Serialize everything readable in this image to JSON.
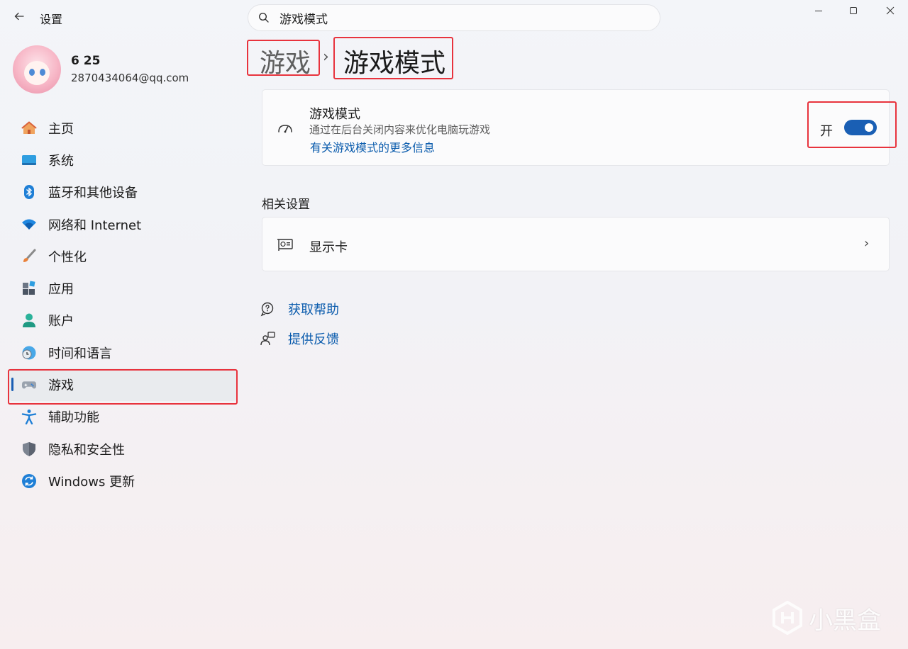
{
  "window": {
    "back_icon": "back-arrow-icon",
    "title": "设置",
    "controls": [
      "minimize-icon",
      "maximize-icon",
      "close-icon"
    ]
  },
  "search": {
    "value": "游戏模式",
    "icon": "search-icon"
  },
  "user": {
    "name": "6 25",
    "email": "2870434064@qq.com"
  },
  "sidebar": {
    "items": [
      {
        "label": "主页",
        "icon": "home-icon"
      },
      {
        "label": "系统",
        "icon": "system-monitor-icon"
      },
      {
        "label": "蓝牙和其他设备",
        "icon": "bluetooth-icon"
      },
      {
        "label": "网络和 Internet",
        "icon": "wifi-icon"
      },
      {
        "label": "个性化",
        "icon": "paintbrush-icon"
      },
      {
        "label": "应用",
        "icon": "apps-icon"
      },
      {
        "label": "账户",
        "icon": "account-icon"
      },
      {
        "label": "时间和语言",
        "icon": "globe-clock-icon"
      },
      {
        "label": "游戏",
        "icon": "gamepad-icon",
        "selected": true
      },
      {
        "label": "辅助功能",
        "icon": "accessibility-icon"
      },
      {
        "label": "隐私和安全性",
        "icon": "shield-icon"
      },
      {
        "label": "Windows 更新",
        "icon": "windows-update-icon"
      }
    ]
  },
  "breadcrumb": {
    "parent": "游戏",
    "separator": "›",
    "current": "游戏模式"
  },
  "game_mode_card": {
    "icon": "game-mode-gauge-icon",
    "title": "游戏模式",
    "description": "通过在后台关闭内容来优化电脑玩游戏",
    "link": "有关游戏模式的更多信息",
    "toggle_label": "开",
    "toggle_on": true
  },
  "related": {
    "title": "相关设置",
    "items": [
      {
        "label": "显示卡",
        "icon": "graphics-card-icon",
        "chevron": "›"
      }
    ]
  },
  "help": {
    "get_help": "获取帮助",
    "feedback": "提供反馈"
  },
  "watermark": {
    "text": "小黑盒"
  },
  "colors": {
    "accent": "#1a5fb4",
    "link": "#0b5cad",
    "annotation_red": "#e8333d"
  }
}
